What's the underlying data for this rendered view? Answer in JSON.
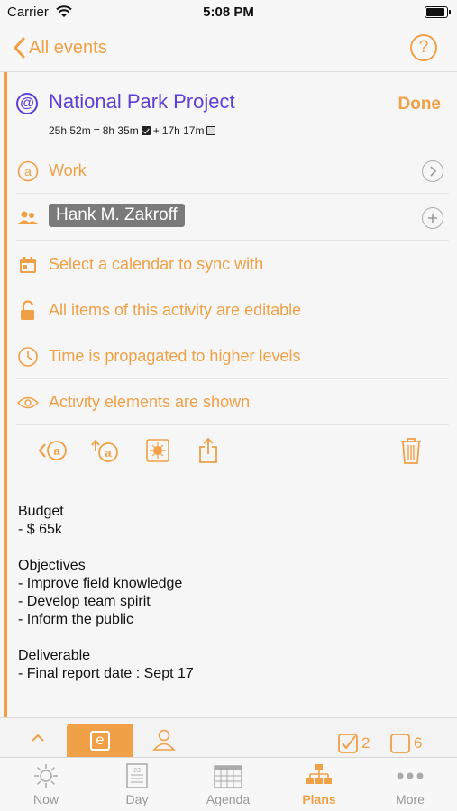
{
  "status_bar": {
    "carrier": "Carrier",
    "time": "5:08 PM"
  },
  "nav": {
    "back_label": "All events",
    "help_label": "?"
  },
  "activity": {
    "title": "National Park Project",
    "done_label": "Done",
    "time_total": "25h 52m",
    "time_eq": "=",
    "time_done": "8h 35m",
    "time_plus": "+",
    "time_open": "17h 17m"
  },
  "rows": {
    "context": "Work",
    "person": "Hank M. Zakroff",
    "calendar": "Select a calendar to sync with",
    "edit": "All items of this activity are editable",
    "time": "Time is propagated to higher levels",
    "visibility": "Activity elements are shown"
  },
  "notes": [
    "Budget",
    "- $ 65k",
    "",
    "Objectives",
    "- Improve field knowledge",
    "- Develop team spirit",
    "- Inform the public",
    "",
    "Deliverable",
    "- Final report date : Sept 17"
  ],
  "sub_tabs": {
    "e_label": "e",
    "checked_count": "2",
    "unchecked_count": "6"
  },
  "tabs": [
    {
      "label": "Now",
      "icon": "sun-icon"
    },
    {
      "label": "Day",
      "icon": "day-calendar-icon"
    },
    {
      "label": "Agenda",
      "icon": "agenda-grid-icon"
    },
    {
      "label": "Plans",
      "icon": "hierarchy-icon"
    },
    {
      "label": "More",
      "icon": "ellipsis-icon"
    }
  ],
  "colors": {
    "accent": "#f0a046",
    "title": "#5b3fd6"
  }
}
